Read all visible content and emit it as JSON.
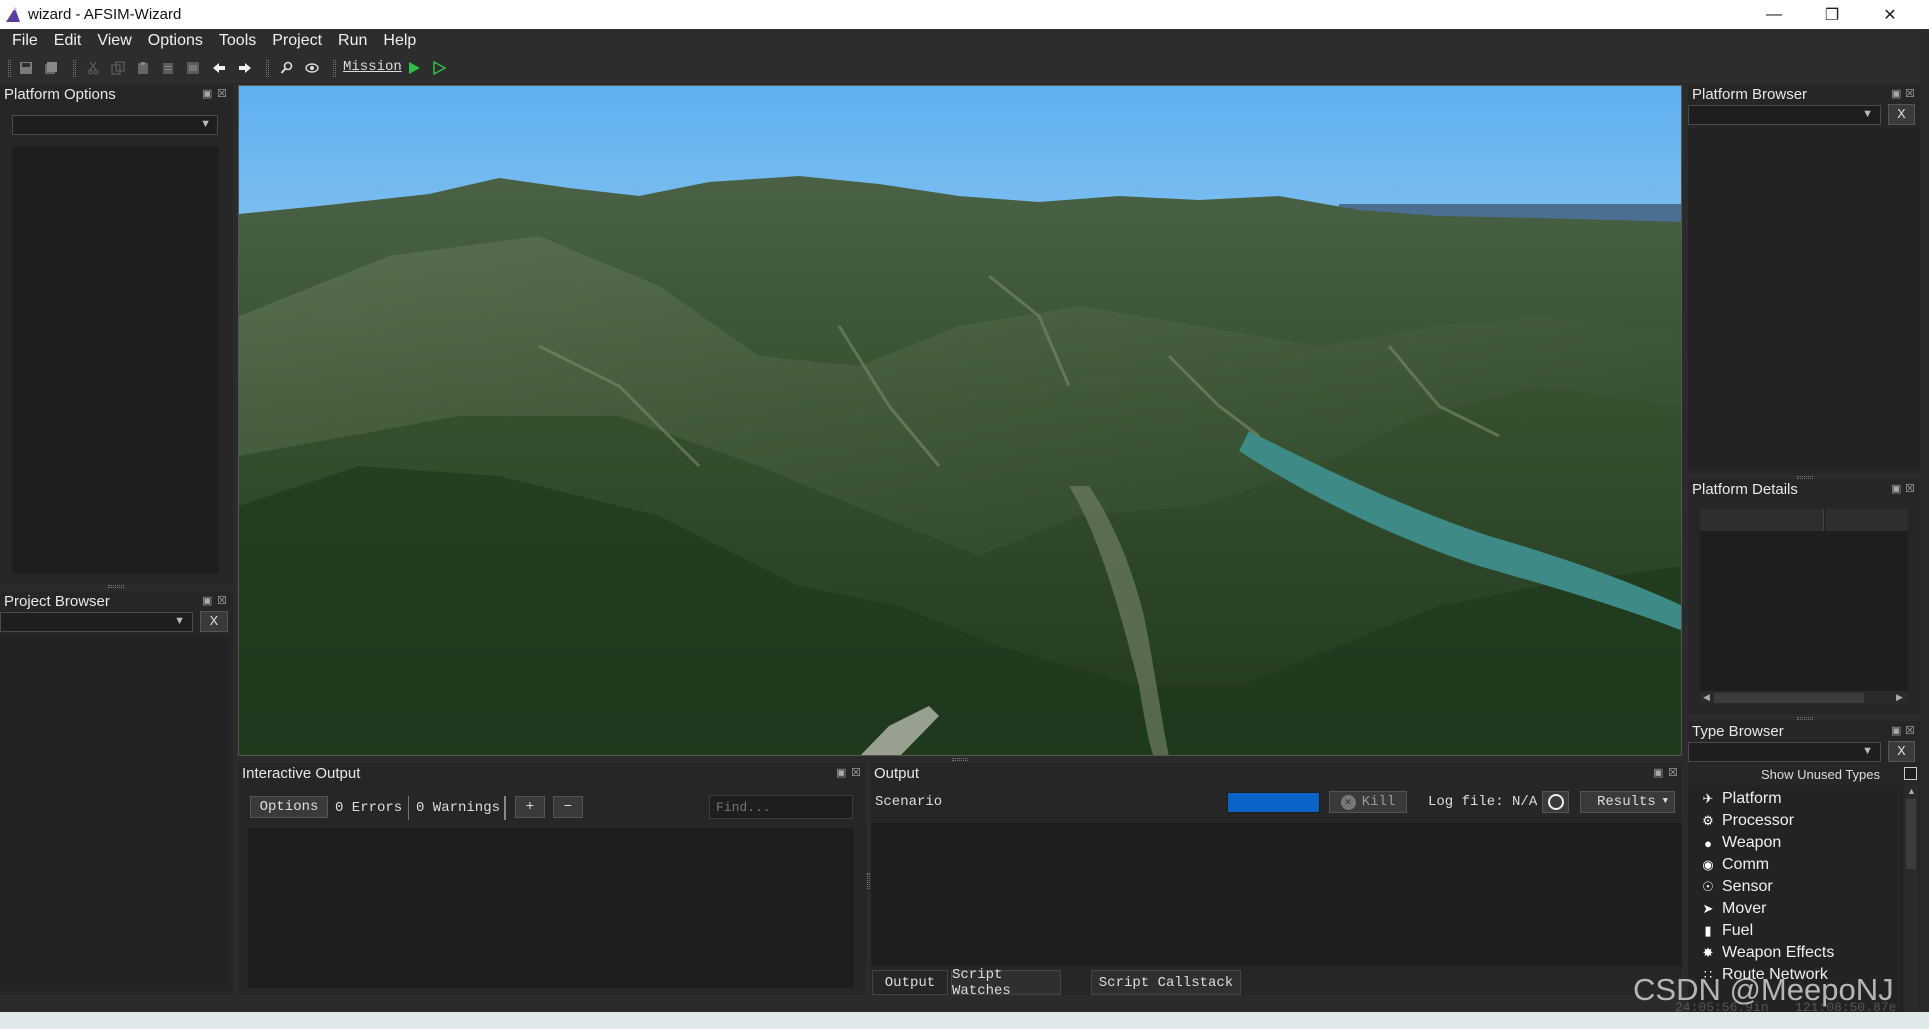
{
  "window": {
    "title": "wizard - AFSIM-Wizard",
    "minimize_icon": "minimize-icon",
    "maximize_icon": "restore-icon",
    "close_icon": "close-icon"
  },
  "menu": [
    "File",
    "Edit",
    "View",
    "Options",
    "Tools",
    "Project",
    "Run",
    "Help"
  ],
  "toolbar": {
    "mission_label": "Mission",
    "icons": [
      "save-icon",
      "save-all-icon",
      "cut-icon",
      "copy-icon",
      "paste-icon",
      "copy-doc-icon",
      "paste-doc-icon",
      "back-arrow-icon",
      "forward-arrow-icon",
      "search-icon",
      "eye-icon",
      "run-icon",
      "run-outline-icon"
    ]
  },
  "platform_options": {
    "title": "Platform Options",
    "combo_value": ""
  },
  "project_browser": {
    "title": "Project Browser",
    "filter_value": "",
    "clear_label": "X"
  },
  "platform_browser": {
    "title": "Platform Browser",
    "filter_value": "",
    "clear_label": "X"
  },
  "platform_details": {
    "title": "Platform Details"
  },
  "type_browser": {
    "title": "Type Browser",
    "clear_label": "X",
    "show_unused_label": "Show Unused Types",
    "show_unused_checked": false,
    "items": [
      {
        "label": "Platform",
        "icon": "platform-icon"
      },
      {
        "label": "Processor",
        "icon": "processor-icon"
      },
      {
        "label": "Weapon",
        "icon": "weapon-icon"
      },
      {
        "label": "Comm",
        "icon": "comm-icon"
      },
      {
        "label": "Sensor",
        "icon": "sensor-icon"
      },
      {
        "label": "Mover",
        "icon": "mover-icon"
      },
      {
        "label": "Fuel",
        "icon": "fuel-icon"
      },
      {
        "label": "Weapon Effects",
        "icon": "weapon-effects-icon"
      },
      {
        "label": "Route Network",
        "icon": "route-network-icon"
      }
    ]
  },
  "interactive_output": {
    "title": "Interactive Output",
    "options_label": "Options",
    "errors_label": "0 Errors",
    "warnings_label": "0 Warnings",
    "plus_label": "+",
    "minus_label": "−",
    "find_placeholder": "Find..."
  },
  "output": {
    "title": "Output",
    "scenario_label": "Scenario",
    "kill_label": "Kill",
    "log_file_label": "Log file: N/A",
    "results_label": "Results",
    "tabs": [
      "Output",
      "Script Watches",
      "Script Callstack"
    ]
  },
  "status": {
    "lat": "24:05:56.9in",
    "lon": "121:08:50.87e",
    "watermark": "CSDN @MeepoNJ"
  },
  "colors": {
    "accent_progress": "#0a64c8",
    "run_green": "#2fbf4a"
  }
}
